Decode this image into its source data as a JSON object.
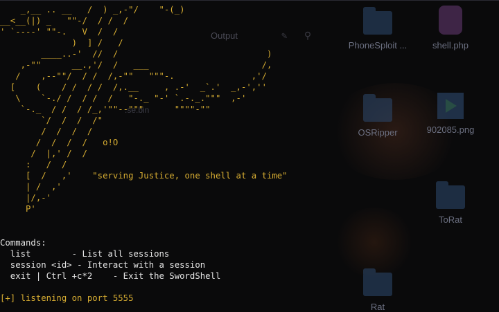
{
  "desktop": {
    "tabs": [
      "Output"
    ],
    "files": [
      {
        "label": "PhoneSploit ...",
        "type": "folder"
      },
      {
        "label": "shell.php",
        "type": "php"
      },
      {
        "label": "OSRipper",
        "type": "folder"
      },
      {
        "label": "902085.png",
        "type": "png"
      },
      {
        "label": "ToRat",
        "type": "folder"
      },
      {
        "label": "Rat",
        "type": "folder"
      }
    ],
    "ghost_files": [
      ".se.bin"
    ]
  },
  "terminal": {
    "banner_art": "    _,__ .. __   /  ) _,-\"/    \"-(_)\n__<__(|) _   \"\"-/  / /  /\n' `----' \"\"-.   V  /  /\n              )  ] /   /\n        ____..-'  //  /                             )\n    ,-\"\"      __.,'/  /   ___                      /,\n   /    ,--\"\"/  / /  /,-\"\"   \"\"\"-.               ,'/\n  [    (    / /  / /  /,.__     , .-'  _`.'  _,-',''\n   \\    `-./ /  / /  /   \"-._ \"-' `.-._.\"\"\"  ,-'\n    `-._  / /  / /_,'\"\"--\"\"\"      \"\"\"\"-\"\"\n        `/  /  /  /\"\n        /  /  /  /\n       /  /  /  /   o!O\n      /  |,' /  /\n     :   /  /\n     [  /   ,'    \"serving Justice, one shell at a time\"\n     | /  ,'\n     |/,-'\n     P'",
    "commands_header": "Commands:",
    "commands": [
      {
        "cmd": "  list        ",
        "desc": "- List all sessions"
      },
      {
        "cmd": "  session <id> ",
        "desc": "- Interact with a session"
      },
      {
        "cmd": "  exit | Ctrl +c*2    ",
        "desc": "- Exit the SwordShell"
      }
    ],
    "status": "[+] listening on port 5555"
  },
  "colors": {
    "background": "#0a0a0b",
    "banner": "#d7ad32",
    "text": "#e6e6e6",
    "status": "#d7ad32"
  }
}
